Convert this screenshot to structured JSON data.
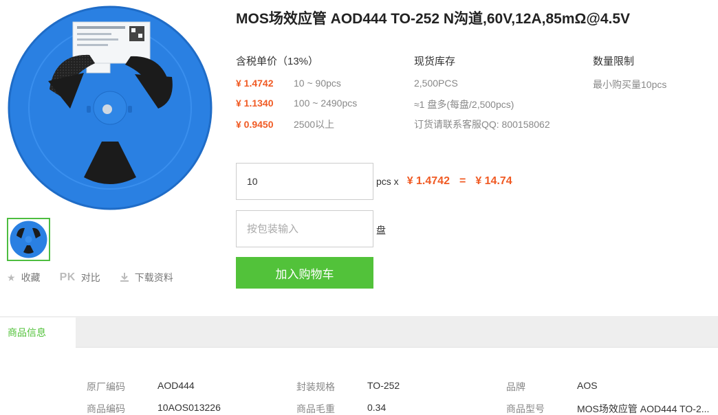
{
  "product": {
    "title": "MOS场效应管 AOD444 TO-252 N沟道,60V,12A,85mΩ@4.5V"
  },
  "gallery": {
    "main_image": "reel-image",
    "thumbnail": "reel-thumbnail"
  },
  "actions": {
    "favorite": {
      "icon": "star-icon",
      "label": "收藏"
    },
    "compare": {
      "icon": "PK",
      "label": "对比"
    },
    "download": {
      "icon": "download-icon",
      "label": "下载资料"
    }
  },
  "pricing": {
    "header": "含税单价（13%）",
    "tiers": [
      {
        "price": "¥ 1.4742",
        "range": "10 ~ 90pcs"
      },
      {
        "price": "¥ 1.1340",
        "range": "100 ~ 2490pcs"
      },
      {
        "price": "¥ 0.9450",
        "range": "2500以上"
      }
    ]
  },
  "stock": {
    "header": "现货库存",
    "lines": [
      "2,500PCS",
      "≈1 盘多(每盘/2,500pcs)",
      "订货请联系客服QQ: 800158062"
    ]
  },
  "limit": {
    "header": "数量限制",
    "text": "最小购买量10pcs"
  },
  "order": {
    "quantity_value": "10",
    "unit_label": "pcs x",
    "unit_price": "¥ 1.4742",
    "equals": "=",
    "total": "¥ 14.74",
    "pack_placeholder": "按包装输入",
    "pack_unit": "盘",
    "add_to_cart": "加入购物车"
  },
  "tabs": {
    "active": "商品信息"
  },
  "info": [
    {
      "label": "原厂编码",
      "value": "AOD444"
    },
    {
      "label": "封装规格",
      "value": "TO-252"
    },
    {
      "label": "品牌",
      "value": "AOS"
    },
    {
      "label": "商品编码",
      "value": "10AOS013226"
    },
    {
      "label": "商品毛重",
      "value": "0.34"
    },
    {
      "label": "商品型号",
      "value": "MOS场效应管 AOD444 TO-2..."
    }
  ],
  "colors": {
    "accent_green": "#52c23a",
    "price_orange": "#f05a23",
    "reel_blue": "#2a7fe0"
  }
}
